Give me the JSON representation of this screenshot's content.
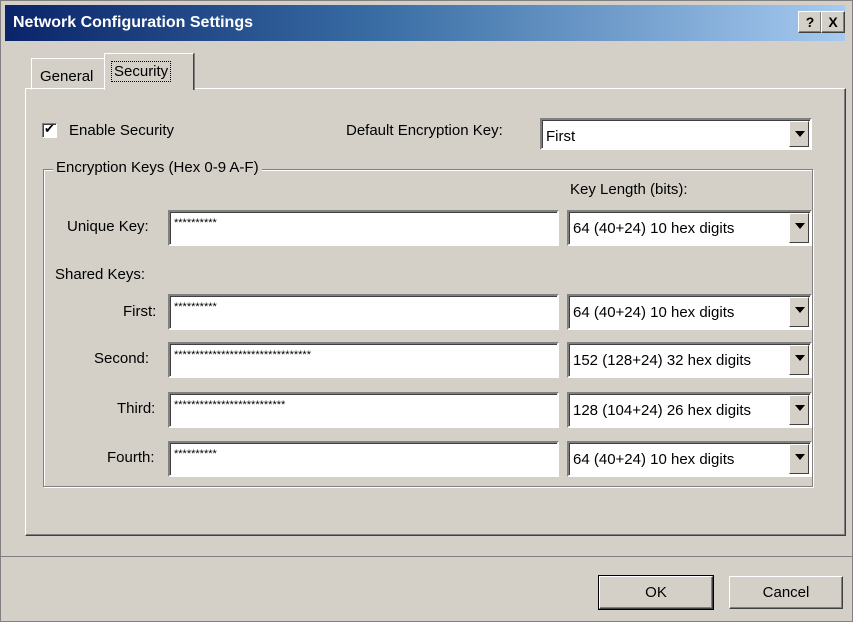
{
  "window": {
    "title": "Network Configuration Settings",
    "help_label": "?",
    "close_label": "X"
  },
  "tabs": [
    {
      "label": "General",
      "active": false
    },
    {
      "label": "Security",
      "active": true
    }
  ],
  "security": {
    "enable_label": "Enable Security",
    "enable_checked": true,
    "default_key_label": "Default Encryption Key:",
    "default_key_value": "First",
    "group_title": "Encryption Keys (Hex 0-9 A-F)",
    "key_length_header": "Key Length (bits):",
    "unique_key": {
      "label": "Unique Key:",
      "value": "**********",
      "length": "64  (40+24)  10 hex digits"
    },
    "shared_keys_label": "Shared Keys:",
    "shared_keys": [
      {
        "label": "First:",
        "value": "**********",
        "length": "64  (40+24)  10 hex digits"
      },
      {
        "label": "Second:",
        "value": "********************************",
        "length": "152 (128+24) 32 hex digits"
      },
      {
        "label": "Third:",
        "value": "**************************",
        "length": "128 (104+24) 26 hex digits"
      },
      {
        "label": "Fourth:",
        "value": "**********",
        "length": "64  (40+24)  10 hex digits"
      }
    ]
  },
  "buttons": {
    "ok_label": "OK",
    "cancel_label": "Cancel"
  }
}
